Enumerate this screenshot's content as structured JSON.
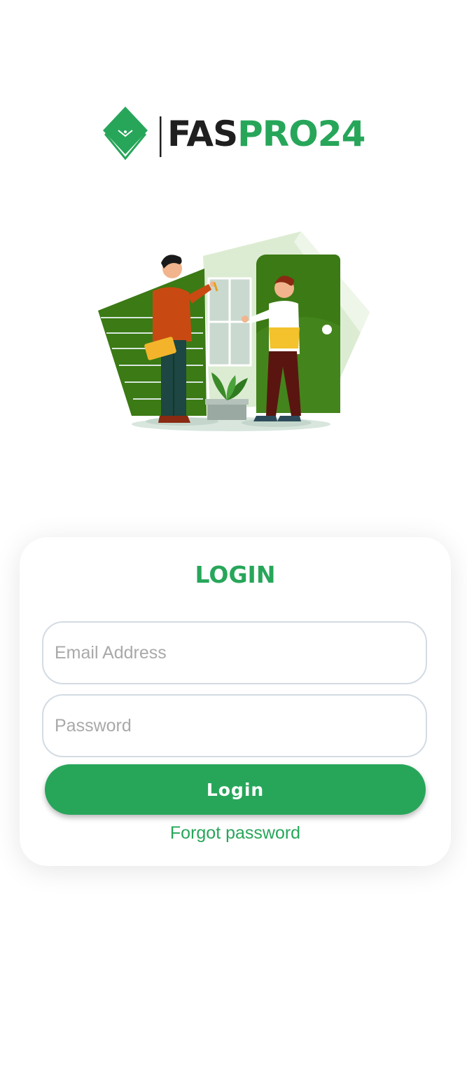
{
  "logo": {
    "text_dark": "FAS",
    "text_green": "PRO24",
    "icon": "faspro-diamond-icon"
  },
  "illustration": {
    "name": "house-key-handover-illustration"
  },
  "login_card": {
    "title": "LOGIN",
    "email": {
      "placeholder": "Email Address",
      "value": ""
    },
    "password": {
      "placeholder": "Password",
      "value": ""
    },
    "login_button_label": "Login",
    "forgot_password_label": "Forgot password"
  },
  "colors": {
    "brand_green": "#27a65a",
    "dark_green": "#3b7a14",
    "text_dark": "#1f1f1f",
    "field_border": "#d3dbe3",
    "placeholder": "#a9a9a9"
  }
}
